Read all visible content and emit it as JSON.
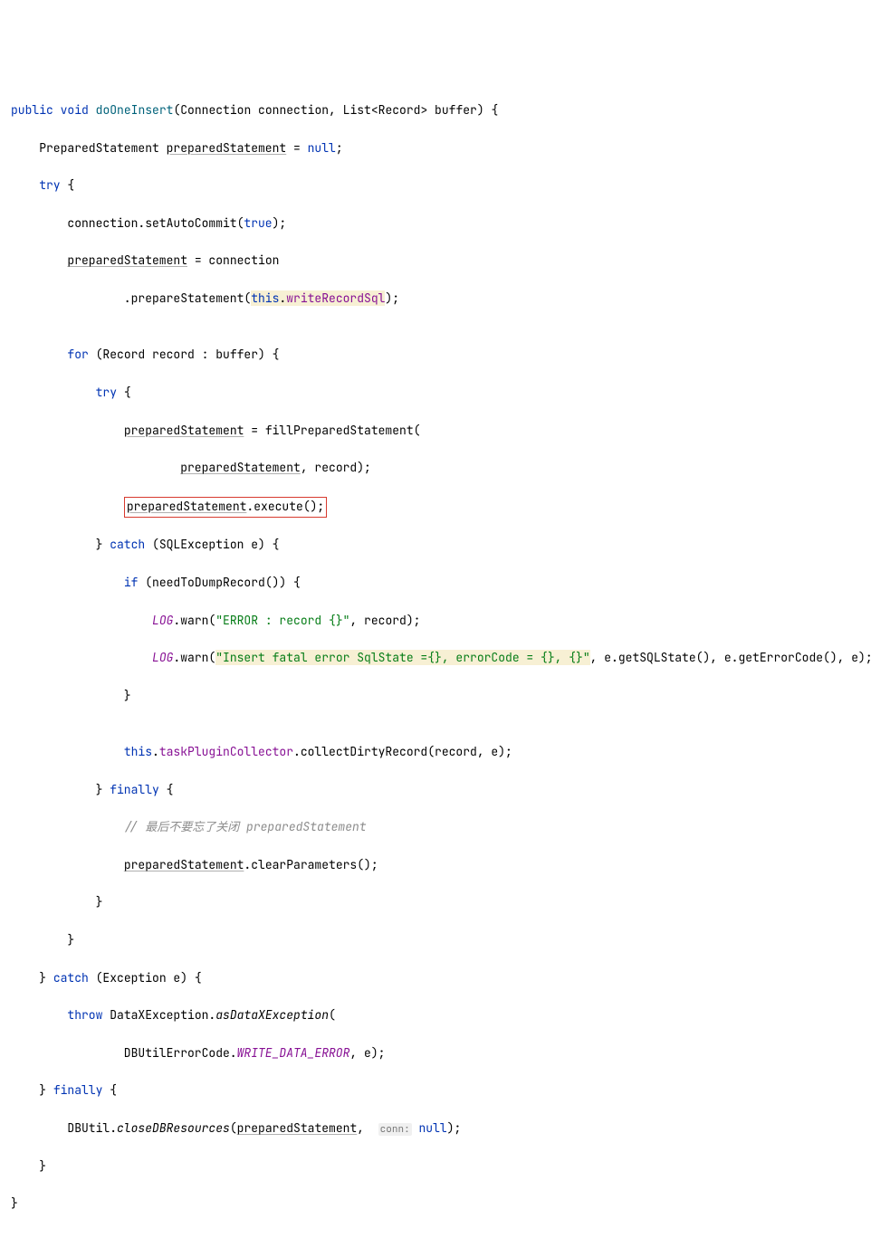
{
  "code": {
    "l1_public": "public",
    "l1_void": "void",
    "l1_method": "doOneInsert",
    "l1_params": "(Connection connection, List<Record> buffer) {",
    "l2_type": "PreparedStatement ",
    "l2_var": "preparedStatement",
    "l2_rest": " = ",
    "l2_null": "null",
    "l2_semi": ";",
    "l3_try": "try",
    "l3_brace": " {",
    "l4": "        connection.setAutoCommit(",
    "l4_true": "true",
    "l4_end": ");",
    "l5_var": "preparedStatement",
    "l5_rest": " = connection",
    "l6_prep": "                .prepareStatement(",
    "l6_this": "this",
    "l6_dot": ".",
    "l6_field": "writeRecordSql",
    "l6_end": ");",
    "l8_for": "for",
    "l8_rest": " (Record record : buffer) {",
    "l9_try": "try",
    "l9_brace": " {",
    "l10_var": "preparedStatement",
    "l10_rest": " = fillPreparedStatement(",
    "l11_var": "preparedStatement",
    "l11_rest": ", record);",
    "l12_var": "preparedStatement",
    "l12_rest": ".execute();",
    "l13_catch": "catch",
    "l13_rest": " (SQLException e) {",
    "l14_if": "if",
    "l14_rest": " (needToDumpRecord()) {",
    "l15_log": "LOG",
    "l15_warn": ".warn(",
    "l15_str": "\"ERROR : record {}\"",
    "l15_end": ", record);",
    "l16_log": "LOG",
    "l16_warn": ".warn(",
    "l16_str": "\"Insert fatal error SqlState ={}, errorCode = {}, {}\"",
    "l16_end": ", e.getSQLState(), e.getErrorCode(), e);",
    "l17": "                }",
    "l19_this": "this",
    "l19_dot": ".",
    "l19_field": "taskPluginCollector",
    "l19_rest": ".collectDirtyRecord(record, e);",
    "l20_finally": "finally",
    "l20_brace": " {",
    "l21_comment": "// 最后不要忘了关闭 preparedStatement",
    "l22_var": "preparedStatement",
    "l22_rest": ".clearParameters();",
    "l23": "            }",
    "l24": "        }",
    "l25_catch": "catch",
    "l25_rest": " (Exception e) {",
    "l26_throw": "throw",
    "l26_rest": " DataXException.",
    "l26_method": "asDataXException",
    "l26_paren": "(",
    "l27_field": "WRITE_DATA_ERROR",
    "l27_pre": "                DBUtilErrorCode.",
    "l27_end": ", e);",
    "l28_finally": "finally",
    "l28_brace": " {",
    "l29_pre": "        DBUtil.",
    "l29_method": "closeDBResources",
    "l29_paren": "(",
    "l29_var": "preparedStatement",
    "l29_comma": ", ",
    "l29_hint": "conn:",
    "l29_null": " null",
    "l29_end": ");",
    "l30": "    }",
    "l31": "}"
  }
}
